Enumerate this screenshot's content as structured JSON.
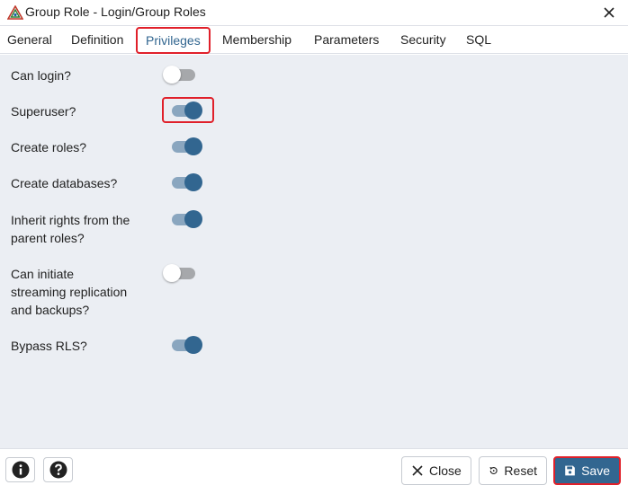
{
  "window": {
    "title": "Group Role - Login/Group Roles",
    "logo_icon": "pgadmin-logo-icon",
    "close_icon": "close-icon"
  },
  "tabs": [
    {
      "label": "General",
      "active": false
    },
    {
      "label": "Definition",
      "active": false
    },
    {
      "label": "Privileges",
      "active": true
    },
    {
      "label": "Membership",
      "active": false
    },
    {
      "label": "Parameters",
      "active": false
    },
    {
      "label": "Security",
      "active": false
    },
    {
      "label": "SQL",
      "active": false
    }
  ],
  "privileges": [
    {
      "label_lines": [
        "Can login?"
      ],
      "value": false
    },
    {
      "label_lines": [
        "Superuser?"
      ],
      "value": true
    },
    {
      "label_lines": [
        "Create roles?"
      ],
      "value": true
    },
    {
      "label_lines": [
        "Create databases?"
      ],
      "value": true
    },
    {
      "label_lines": [
        "Inherit rights from the",
        "parent roles?"
      ],
      "value": true
    },
    {
      "label_lines": [
        "Can initiate",
        "streaming replication",
        "and backups?"
      ],
      "value": false
    },
    {
      "label_lines": [
        "Bypass RLS?"
      ],
      "value": true
    }
  ],
  "footer": {
    "info_icon": "info-icon",
    "help_icon": "help-icon",
    "close_label": "Close",
    "reset_label": "Reset",
    "save_label": "Save"
  },
  "colors": {
    "accent": "#326690",
    "highlight": "#e0202a",
    "panel_bg": "#ebeef3"
  }
}
